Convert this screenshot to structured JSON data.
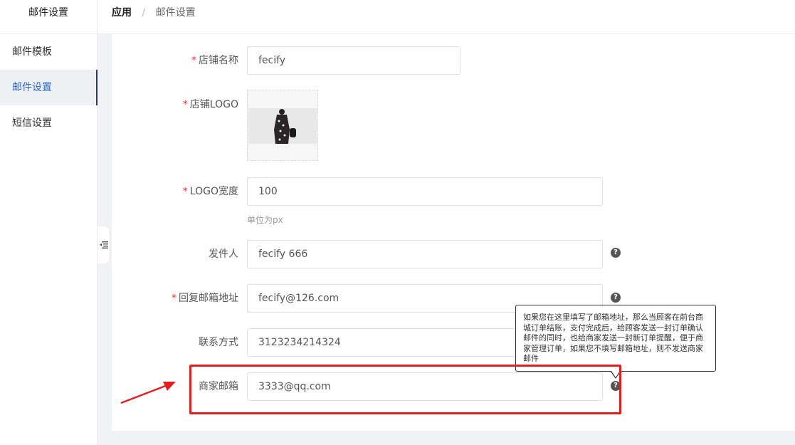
{
  "sidebar": {
    "title": "邮件设置",
    "items": [
      {
        "label": "邮件模板",
        "active": false
      },
      {
        "label": "邮件设置",
        "active": true
      },
      {
        "label": "短信设置",
        "active": false
      }
    ]
  },
  "breadcrumb": {
    "root": "应用",
    "separator": "/",
    "current": "邮件设置"
  },
  "form": {
    "shop_name": {
      "label": "店铺名称",
      "required_mark": "*",
      "value": "fecify"
    },
    "shop_logo": {
      "label": "店铺LOGO",
      "required_mark": "*"
    },
    "logo_width": {
      "label": "LOGO宽度",
      "required_mark": "*",
      "value": "100",
      "hint": "单位为px"
    },
    "sender": {
      "label": "发件人",
      "value": "fecify 666",
      "help": "?"
    },
    "reply_email": {
      "label": "回复邮箱地址",
      "required_mark": "*",
      "value": "fecify@126.com",
      "help": "?"
    },
    "contact": {
      "label": "联系方式",
      "value": "3123234214324"
    },
    "merchant_email": {
      "label": "商家邮箱",
      "value": "3333@qq.com",
      "help": "?"
    }
  },
  "tooltip": {
    "text": "如果您在这里填写了邮箱地址，那么当顾客在前台商城订单结账，支付完成后，给顾客发送一封订单确认邮件的同时，也给商家发送一封新订单提醒，便于商家管理订单，如果您不填写邮箱地址，则不发送商家邮件"
  },
  "annotation": {
    "color": "#e02020"
  },
  "icons": {
    "collapse": "outdent-icon",
    "help": "question-circle-icon"
  }
}
